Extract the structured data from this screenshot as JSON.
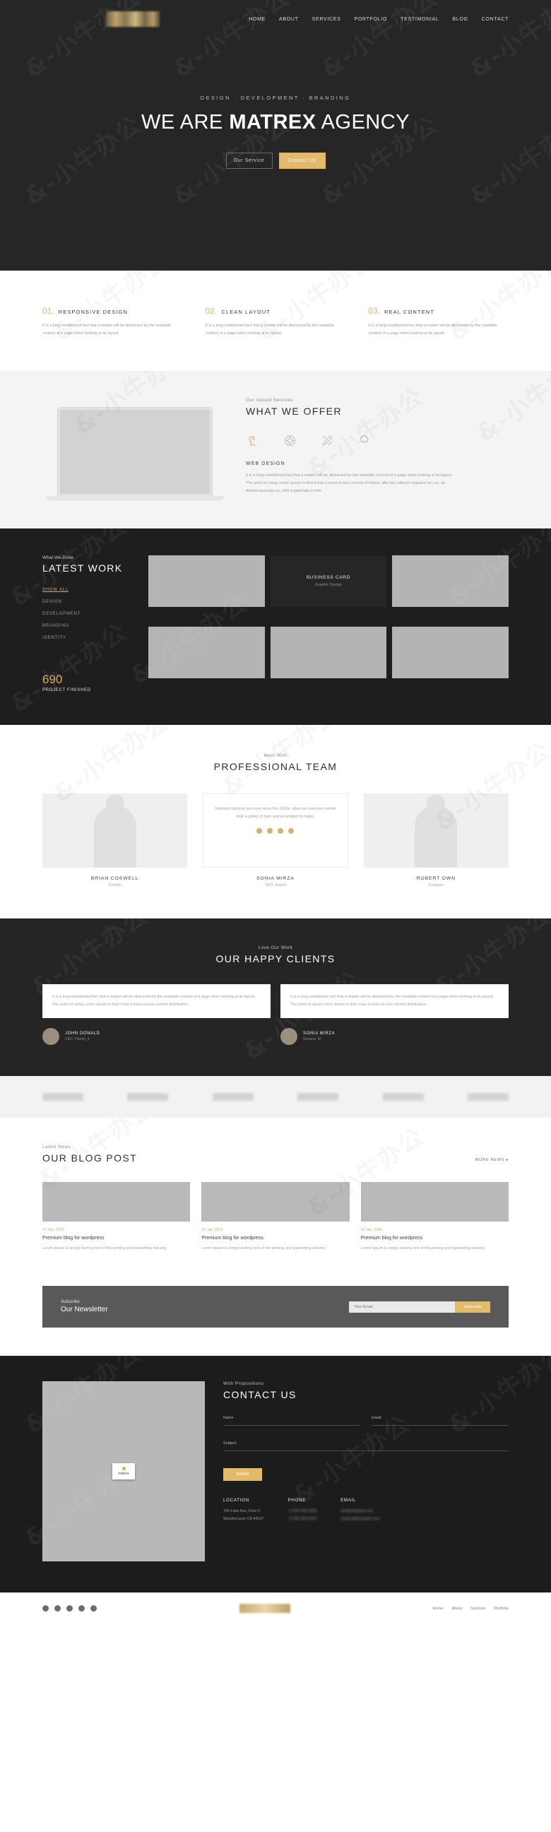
{
  "nav": {
    "logo_alt": "matrex-logo",
    "items": [
      "HOME",
      "ABOUT",
      "SERVICES",
      "PORTFOLIO",
      "TESTIMONIAL",
      "BLOG",
      "CONTACT"
    ]
  },
  "hero": {
    "subtitle": "DESIGN  ·  DEVELOPMENT  ·  BRANDING",
    "title_pre": "WE ARE ",
    "title_bold": "MATREX",
    "title_post": " AGENCY",
    "btn_primary": "Our Service",
    "btn_secondary": "Contact Us",
    "bg_color": "#262626",
    "accent_color": "#e3b96a"
  },
  "features": [
    {
      "num": "01.",
      "title": "RESPONSIVE DESIGN",
      "body": "It is a long established fact that a reader will be distracted by the readable content of a page when looking at its layout."
    },
    {
      "num": "02.",
      "title": "CLEAN LAYOUT",
      "body": "It is a long established fact that a reader will be distracted by the readable content of a page when looking at its layout."
    },
    {
      "num": "03.",
      "title": "REAL CONTENT",
      "body": "It is a long established fact that a reader will be distracted by the readable content of a page when looking at its layout."
    }
  ],
  "offer": {
    "kicker": "Our Valued Services",
    "title": "WHAT WE OFFER",
    "icons": [
      "monitor-icon",
      "aperture-icon",
      "pencil-ruler-icon",
      "puzzle-icon"
    ],
    "active_icon": "monitor-icon",
    "sub": "WEB DESIGN",
    "body": "It is a long established fact that a reader will be distracted by the readable content of a page when looking at its layout. The point of using Lorem Ipsum is that it has a more-or-less normal of letters, aliis tum aliorum loquatur nec eo, ab delirant periculis eu, nihil expetendis in mel."
  },
  "work": {
    "kicker": "What We Done",
    "title": "LATEST WORK",
    "filters": [
      "SHOW ALL",
      "DESIGN",
      "DEVELOPMENT",
      "BRANDING",
      "IDENTITY"
    ],
    "active_filter": "SHOW ALL",
    "counter_number": "690",
    "counter_label": "PROJECT FINISHED",
    "tiles": [
      {
        "type": "image",
        "title": "",
        "subtitle": ""
      },
      {
        "type": "card",
        "title": "BUSINESS CARD",
        "subtitle": "Graphic Design"
      },
      {
        "type": "image",
        "title": "",
        "subtitle": ""
      },
      {
        "type": "image",
        "title": "",
        "subtitle": ""
      },
      {
        "type": "image",
        "title": "",
        "subtitle": ""
      },
      {
        "type": "image",
        "title": "",
        "subtitle": ""
      }
    ]
  },
  "team": {
    "kicker": "Meet With",
    "title": "PROFESSIONAL TEAM",
    "quote": "Standard dummy text ever since the 1500s, when an unknown printer took a galley of type and scrambled to make.",
    "members": [
      {
        "name": "BRIAN COSWELL",
        "role": "Founde"
      },
      {
        "name": "SONIA MIRZA",
        "role": "SEO, Expert"
      },
      {
        "name": "ROBERT DWN",
        "role": "Designer"
      }
    ]
  },
  "clients": {
    "kicker": "Love Our Work",
    "title": "OUR HAPPY CLIENTS",
    "testimonials": [
      {
        "text": "It is a long established fact that a reader will be distracted by the readable content of a page when looking at its layout. The point of using Lorem Ipsum is that it has a more-or-less normal distribution.",
        "name": "JOHN DONALD",
        "role": "CEO, Theme_it"
      },
      {
        "text": "It is a long established fact that a reader will be distracted by the readable content of a page when looking at its layout. The point of using Lorem Ipsum is that it has a more-or-less normal distribution.",
        "name": "SONIA MIRZA",
        "role": "General, M"
      }
    ]
  },
  "client_logos": [
    "logo-1",
    "logo-2",
    "logo-3",
    "logo-4",
    "logo-5",
    "logo-6"
  ],
  "blog": {
    "kicker": "Latest News",
    "title": "OUR BLOG POST",
    "more_label": "MORE NEWS ▸",
    "posts": [
      {
        "date": "27 Jan, 2019",
        "title": "Premium blog for wordpress",
        "body": "Lorem Ipsum is simply dummy text of the printing and typesetting industry."
      },
      {
        "date": "21 Jan, 2019",
        "title": "Premium blog for wordpress",
        "body": "Lorem Ipsum is simply dummy text of the printing and typesetting industry."
      },
      {
        "date": "15 Jan, 2019",
        "title": "Premium blog for wordpress",
        "body": "Lorem Ipsum is simply dummy text of the printing and typesetting industry."
      }
    ]
  },
  "newsletter": {
    "kicker": "Subscribe",
    "title": "Our Newsletter",
    "placeholder": "Your Email",
    "button": "Subscribe"
  },
  "contact": {
    "kicker": "With Propositions",
    "title": "CONTACT US",
    "map_pin": "matrex",
    "fields": [
      {
        "label": "Name"
      },
      {
        "label": "Email"
      },
      {
        "label": "Subject"
      }
    ],
    "submit": "Submit",
    "info": [
      {
        "heading": "LOCATION",
        "line1": "795 Fake Ave, Door 6",
        "line2": "WonderLand, CA 94107",
        "blurred": false
      },
      {
        "heading": "PHONE",
        "line1": "+1 000 000 0000",
        "line2": "+1 000 000 0000",
        "blurred": true
      },
      {
        "heading": "EMAIL",
        "line1": "info@example.com",
        "line2": "support@example.com",
        "blurred": true
      }
    ]
  },
  "footer": {
    "socials": [
      "facebook-icon",
      "twitter-icon",
      "linkedin-icon",
      "instagram-icon",
      "pinterest-icon"
    ],
    "menu": [
      "Home",
      "About",
      "Services",
      "Portfolio"
    ]
  },
  "watermark": "&-小牛办公"
}
